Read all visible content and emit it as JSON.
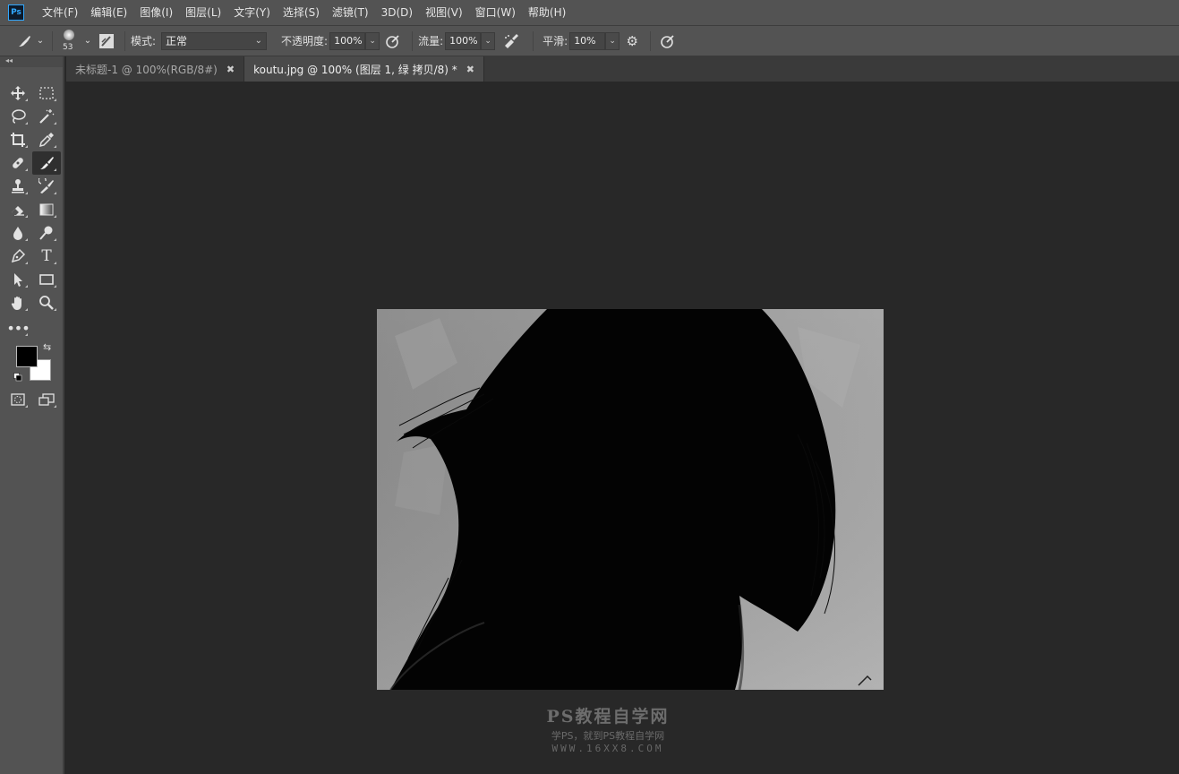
{
  "app": {
    "logo": "Ps",
    "menu": [
      "文件(F)",
      "编辑(E)",
      "图像(I)",
      "图层(L)",
      "文字(Y)",
      "选择(S)",
      "滤镜(T)",
      "3D(D)",
      "视图(V)",
      "窗口(W)",
      "帮助(H)"
    ]
  },
  "options": {
    "brush_size": "53",
    "mode_label": "模式:",
    "mode_value": "正常",
    "opacity_label": "不透明度:",
    "opacity_value": "100%",
    "flow_label": "流量:",
    "flow_value": "100%",
    "smoothing_label": "平滑:",
    "smoothing_value": "10%"
  },
  "tabs": [
    {
      "label": "未标题-1 @ 100%(RGB/8#)",
      "active": false
    },
    {
      "label": "koutu.jpg @ 100% (图层 1, 绿 拷贝/8) *",
      "active": true
    }
  ],
  "tools": [
    [
      "move-icon",
      "marquee-icon"
    ],
    [
      "lasso-icon",
      "magic-wand-icon"
    ],
    [
      "crop-icon",
      "eyedropper-icon"
    ],
    [
      "healing-brush-icon",
      "brush-icon"
    ],
    [
      "clone-stamp-icon",
      "history-brush-icon"
    ],
    [
      "eraser-icon",
      "gradient-icon"
    ],
    [
      "blur-icon",
      "dodge-icon"
    ],
    [
      "pen-icon",
      "type-icon"
    ],
    [
      "path-select-icon",
      "rectangle-icon"
    ],
    [
      "hand-icon",
      "zoom-icon"
    ]
  ],
  "colors": {
    "foreground": "#000000",
    "background": "#ffffff"
  },
  "watermark": {
    "title": "PS教程自学网",
    "subtitle": "学PS，就到PS教程自学网",
    "url": "WWW.16XX8.COM"
  }
}
